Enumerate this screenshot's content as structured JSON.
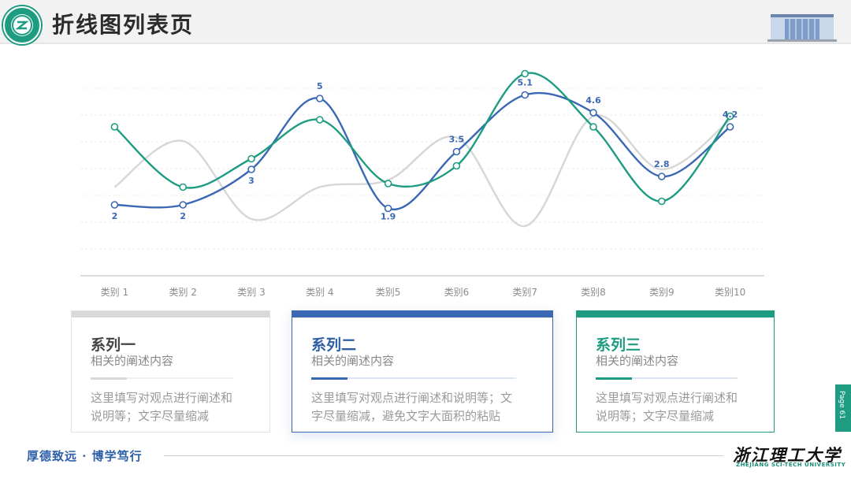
{
  "header": {
    "title": "折线图列表页"
  },
  "chart_data": {
    "type": "line",
    "categories": [
      "类别 1",
      "类别 2",
      "类别 3",
      "类别 4",
      "类别5",
      "类别6",
      "类别7",
      "类别8",
      "类别9",
      "类别10"
    ],
    "ylim": [
      0,
      6
    ],
    "grid": true,
    "series": [
      {
        "values": [
          2.5,
          3.8,
          1.6,
          2.5,
          2.7,
          3.9,
          1.4,
          4.5,
          3.0,
          4.4
        ],
        "color": "#d6d6d6",
        "markers": false,
        "labels": false
      },
      {
        "values": [
          2,
          2,
          3,
          5,
          1.9,
          3.5,
          5.1,
          4.6,
          2.8,
          4.2
        ],
        "color": "#3a68b4",
        "markers": true,
        "labels": true
      },
      {
        "values": [
          4.2,
          2.5,
          3.3,
          4.4,
          2.6,
          3.1,
          5.7,
          4.2,
          2.1,
          4.5
        ],
        "color": "#1d9c82",
        "markers": true,
        "labels": false
      }
    ]
  },
  "cards": [
    {
      "title": "系列一",
      "subtitle": "相关的阐述内容",
      "desc_line1": "这里填写对观点进行阐述和",
      "desc_line2": "说明等；文字尽量缩减",
      "color": "#d9d9d9",
      "title_color": "#444444"
    },
    {
      "title": "系列二",
      "subtitle": "相关的阐述内容",
      "desc_line1": "这里填写对观点进行阐述和说明等；文",
      "desc_line2": "字尽量缩减，避免文字大面积的粘贴",
      "color": "#3a68b4",
      "title_color": "#2c5fa8"
    },
    {
      "title": "系列三",
      "subtitle": "相关的阐述内容",
      "desc_line1": "这里填写对观点进行阐述和",
      "desc_line2": "说明等；文字尽量缩减",
      "color": "#1d9c82",
      "title_color": "#1d9c82"
    }
  ],
  "footer": {
    "motto": "厚德致远 · 博学笃行",
    "university_cn": "浙江理工大学",
    "university_en": "ZHEJIANG SCI-TECH UNIVERSITY",
    "page_label": "Page 61"
  }
}
